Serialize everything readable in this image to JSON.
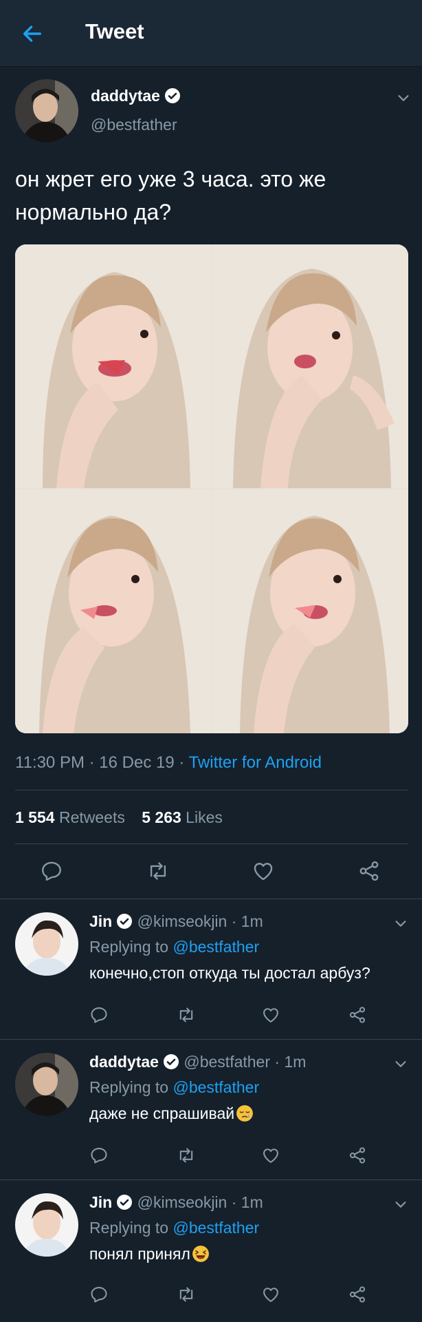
{
  "header": {
    "back_icon": "arrow-left-icon",
    "title": "Tweet"
  },
  "tweet": {
    "author_name": "daddytae",
    "author_handle": "@bestfather",
    "verified_icon": "verified-badge-icon",
    "text": "он жрет его уже 3 часа. это же нормально да?",
    "photos_count": 4,
    "time": "11:30 PM · 16 Dec 19 · ",
    "source": "Twitter for Android",
    "retweets_count": "1 554",
    "retweets_label": "Retweets",
    "likes_count": "5 263",
    "likes_label": "Likes",
    "actions": [
      "reply-icon",
      "retweet-icon",
      "like-icon",
      "share-icon"
    ]
  },
  "replies": [
    {
      "name": "Jin",
      "handle": "@kimseokjin · 1m",
      "replying_prefix": "Replying to ",
      "replying_to": "@bestfather",
      "text": "конечно,стоп откуда ты достал арбуз?",
      "emoji": ""
    },
    {
      "name": "daddytae",
      "handle": "@bestfather · 1m",
      "replying_prefix": "Replying to ",
      "replying_to": "@bestfather",
      "text": "даже не спрашивай",
      "emoji": "sleepy-face-emoji"
    },
    {
      "name": "Jin",
      "handle": "@kimseokjin · 1m",
      "replying_prefix": "Replying to ",
      "replying_to": "@bestfather",
      "text": "понял принял",
      "emoji": "laughing-face-emoji"
    }
  ],
  "colors": {
    "background": "#15202b",
    "header": "#1b2836",
    "accent": "#1da1f2",
    "muted": "#8899a6",
    "divider": "#38444d"
  }
}
